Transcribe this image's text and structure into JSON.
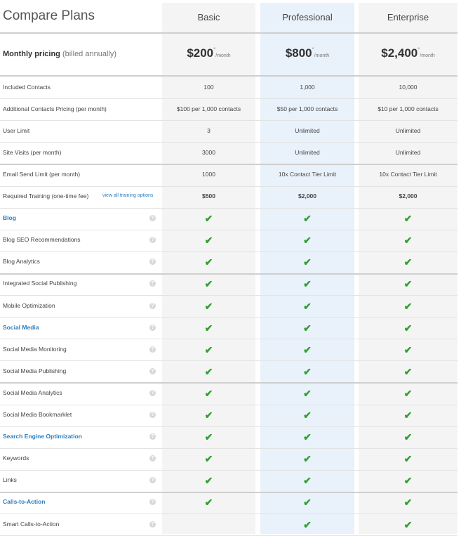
{
  "header": {
    "title": "Compare Plans",
    "plans": [
      "Basic",
      "Professional",
      "Enterprise"
    ]
  },
  "pricing": {
    "label": "Monthly pricing",
    "sublabel": "(billed annually)",
    "prices": [
      "$200",
      "$800",
      "$2,400"
    ],
    "asterisk": "*",
    "per": "/month"
  },
  "value_rows": [
    {
      "label": "Included Contacts",
      "values": [
        "100",
        "1,000",
        "10,000"
      ]
    },
    {
      "label": "Additional Contacts Pricing (per month)",
      "values": [
        "$100 per 1,000 contacts",
        "$50 per 1,000 contacts",
        "$10 per 1,000 contacts"
      ]
    },
    {
      "label": "User Limit",
      "values": [
        "3",
        "Unlimited",
        "Unlimited"
      ]
    },
    {
      "label": "Site Visits (per month)",
      "values": [
        "3000",
        "Unlimited",
        "Unlimited"
      ]
    },
    {
      "label": "Email Send Limit (per month)",
      "values": [
        "1000",
        "10x Contact Tier Limit",
        "10x Contact Tier Limit"
      ]
    },
    {
      "label": "Required Training (one-time fee)",
      "link": "view all training options",
      "values": [
        "$500",
        "$2,000",
        "$2,000"
      ],
      "bold": true
    }
  ],
  "feature_rows": [
    {
      "label": "Blog",
      "section": true,
      "checks": [
        true,
        true,
        true
      ]
    },
    {
      "label": "Blog SEO Recommendations",
      "checks": [
        true,
        true,
        true
      ]
    },
    {
      "label": "Blog Analytics",
      "checks": [
        true,
        true,
        true
      ]
    },
    {
      "label": "Integrated Social Publishing",
      "checks": [
        true,
        true,
        true
      ]
    },
    {
      "label": "Mobile Optimization",
      "checks": [
        true,
        true,
        true
      ]
    },
    {
      "label": "Social Media",
      "section": true,
      "checks": [
        true,
        true,
        true
      ]
    },
    {
      "label": "Social Media Monitoring",
      "checks": [
        true,
        true,
        true
      ]
    },
    {
      "label": "Social Media Publishing",
      "checks": [
        true,
        true,
        true
      ]
    },
    {
      "label": "Social Media Analytics",
      "checks": [
        true,
        true,
        true
      ]
    },
    {
      "label": "Social Media Bookmarklet",
      "checks": [
        true,
        true,
        true
      ]
    },
    {
      "label": "Search Engine Optimization",
      "section": true,
      "checks": [
        true,
        true,
        true
      ]
    },
    {
      "label": "Keywords",
      "checks": [
        true,
        true,
        true
      ]
    },
    {
      "label": "Links",
      "checks": [
        true,
        true,
        true
      ]
    },
    {
      "label": "Calls-to-Action",
      "section": true,
      "checks": [
        true,
        true,
        true
      ]
    },
    {
      "label": "Smart Calls-to-Action",
      "checks": [
        false,
        true,
        true
      ]
    }
  ],
  "icons": {
    "help": "question-mark-icon",
    "check": "checkmark-icon"
  },
  "colors": {
    "link": "#2a7ec1",
    "check": "#2fa12f",
    "pro_column": "#e9f1fb"
  }
}
